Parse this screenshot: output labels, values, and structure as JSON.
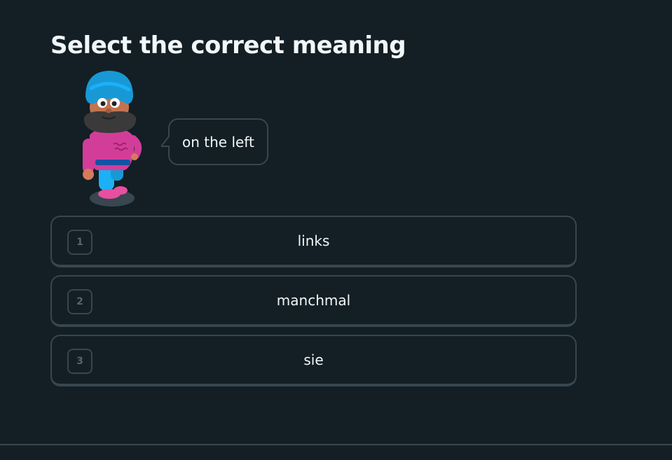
{
  "challenge": {
    "heading": "Select the correct meaning",
    "prompt": "on the left"
  },
  "options": [
    {
      "key": "1",
      "text": "links"
    },
    {
      "key": "2",
      "text": "manchmal"
    },
    {
      "key": "3",
      "text": "sie"
    }
  ],
  "colors": {
    "background": "#131f24",
    "border": "#37464f",
    "text": "#f1f7fb",
    "key_text": "#52656d"
  },
  "icons": {
    "character": "character-illustration",
    "bubble_tail": "speech-bubble-tail"
  }
}
